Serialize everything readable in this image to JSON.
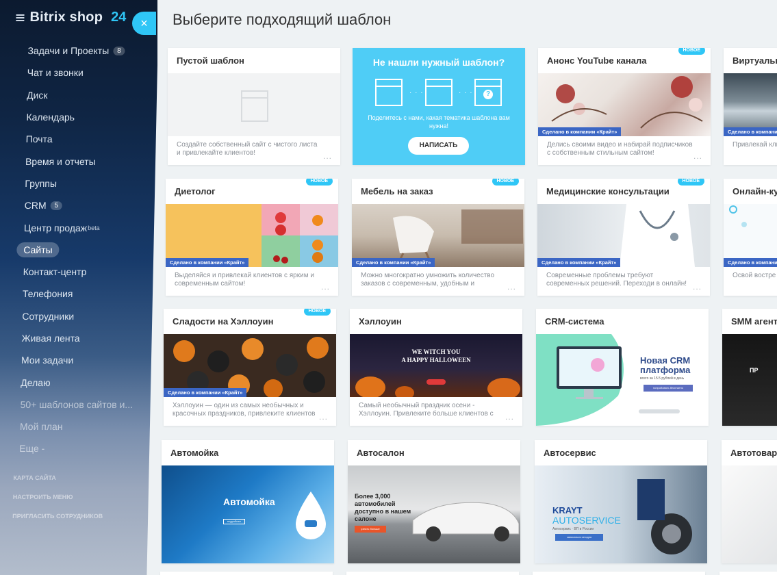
{
  "app": {
    "name": "Bitrix shop",
    "num": "24"
  },
  "sidebar": {
    "items": [
      {
        "label": "Задачи и Проекты",
        "counter": "8"
      },
      {
        "label": "Чат и звонки"
      },
      {
        "label": "Диск"
      },
      {
        "label": "Календарь"
      },
      {
        "label": "Почта"
      },
      {
        "label": "Время и отчеты"
      },
      {
        "label": "Группы"
      },
      {
        "label": "CRM",
        "counter": "5"
      },
      {
        "label": "Центр продаж",
        "sup": "beta"
      },
      {
        "label": "Сайты",
        "active": true
      },
      {
        "label": "Контакт-центр"
      },
      {
        "label": "Телефония"
      },
      {
        "label": "Сотрудники"
      },
      {
        "label": "Живая лента"
      },
      {
        "label": "Мои задачи"
      },
      {
        "label": "Делаю"
      },
      {
        "label": "50+ шаблонов сайтов и..."
      },
      {
        "label": "Мой план"
      },
      {
        "label": "Еще -"
      }
    ],
    "footer": [
      "Карта сайта",
      "Настроить меню",
      "Пригласить сотрудников"
    ]
  },
  "close_label": "×",
  "page_title": "Выберите подходящий шаблон",
  "badge_label": "новое",
  "krayt_label": "Сделано в компании «Крайт»",
  "dots": "...",
  "help_card": {
    "title": "Не нашли нужный шаблон?",
    "text": "Поделитесь с нами, какая тематика шаблона вам нужна!",
    "button": "НАПИСАТЬ",
    "dots": "· · ·",
    "q": "?"
  },
  "cards": [
    {
      "id": "blank",
      "title": "Пустой шаблон",
      "desc": "Создайте собственный сайт с чистого листа и привлекайте клиентов!"
    },
    {
      "id": "youtube",
      "title": "Анонс YouTube канала",
      "desc": "Делись своими видео и набирай подписчиков с собственным стильным сайтом!",
      "badge": true,
      "krayt": true
    },
    {
      "id": "virtual",
      "title": "Виртуальн",
      "desc": "Привлекай клиентов среди конкуре",
      "krayt": true
    },
    {
      "id": "diet",
      "title": "Диетолог",
      "desc": "Выделяйся и привлекай клиентов с ярким и современным сайтом!",
      "badge": true,
      "krayt": true
    },
    {
      "id": "furniture",
      "title": "Мебель на заказ",
      "desc": "Можно многократно умножить количество заказов с современным, удобным и стильным сайтом",
      "badge": true,
      "krayt": true
    },
    {
      "id": "medical",
      "title": "Медицинские консультации",
      "desc": "Современные проблемы требуют современных решений. Переходи в онлайн!",
      "badge": true,
      "krayt": true
    },
    {
      "id": "online",
      "title": "Онлайн-ку",
      "desc": "Освой востре",
      "krayt": true
    },
    {
      "id": "sweets",
      "title": "Сладости на Хэллоуин",
      "desc": "Хэллоуин — один из самых необычных и красочных праздников, привлеките клиентов",
      "badge": true,
      "krayt": true
    },
    {
      "id": "halloween",
      "title": "Хэллоуин",
      "desc": "Самый необычный праздник осени - Хэллоуин. Привлеките больше клиентов с помощью сайта",
      "art": [
        "WE WITCH YOU",
        "A HAPPY HALLOWEEN"
      ]
    },
    {
      "id": "crm",
      "title": "CRM-система",
      "art": [
        "Новая CRM платформа",
        "всего за 15.5 рублей в день",
        "попробовать бесплатно"
      ]
    },
    {
      "id": "smm",
      "title": "SMM агент",
      "art": [
        "ПР"
      ]
    },
    {
      "id": "carwash",
      "title": "Автомойка",
      "art": [
        "Автомойка",
        "подробнее"
      ]
    },
    {
      "id": "carsalon",
      "title": "Автосалон",
      "art": [
        "Более 3,000 автомобилей доступно в нашем салоне",
        "узнать больше"
      ]
    },
    {
      "id": "autoservice",
      "title": "Автосервис",
      "art": [
        "KRAYT",
        "AUTOSERVICE",
        "Автосервис · ВП в России",
        "записаться сегодня"
      ]
    },
    {
      "id": "autoparts",
      "title": "Автотовары"
    }
  ],
  "colors": {
    "accent": "#2fc6f6",
    "krayt": "#3b66c4",
    "help_bg": "#4fcdf6"
  }
}
